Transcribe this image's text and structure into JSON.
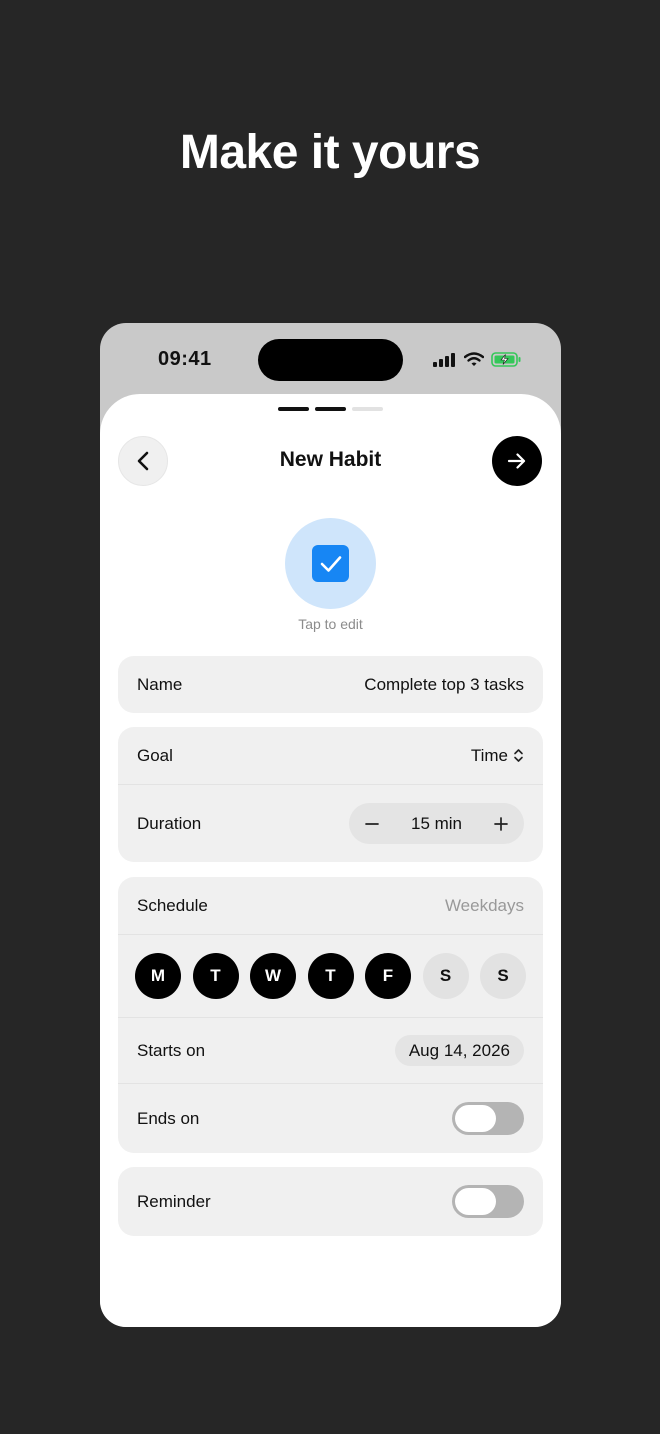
{
  "headline": "Make it yours",
  "status_bar": {
    "time": "09:41"
  },
  "progress": {
    "total_steps": 3,
    "current_step": 2
  },
  "header": {
    "title": "New Habit"
  },
  "habit_icon": {
    "caption": "Tap to edit",
    "icon": "checkmark-square-icon",
    "color": "#1786f4",
    "background": "#cfe5fb"
  },
  "form": {
    "name": {
      "label": "Name",
      "value": "Complete top 3 tasks"
    },
    "goal": {
      "label": "Goal",
      "value": "Time"
    },
    "duration": {
      "label": "Duration",
      "value": "15 min"
    },
    "schedule": {
      "label": "Schedule",
      "value": "Weekdays",
      "days": [
        {
          "letter": "M",
          "selected": true
        },
        {
          "letter": "T",
          "selected": true
        },
        {
          "letter": "W",
          "selected": true
        },
        {
          "letter": "T",
          "selected": true
        },
        {
          "letter": "F",
          "selected": true
        },
        {
          "letter": "S",
          "selected": false
        },
        {
          "letter": "S",
          "selected": false
        }
      ]
    },
    "starts_on": {
      "label": "Starts on",
      "value": "Aug 14, 2026"
    },
    "ends_on": {
      "label": "Ends on",
      "enabled": false
    },
    "reminder": {
      "label": "Reminder",
      "enabled": false
    }
  }
}
